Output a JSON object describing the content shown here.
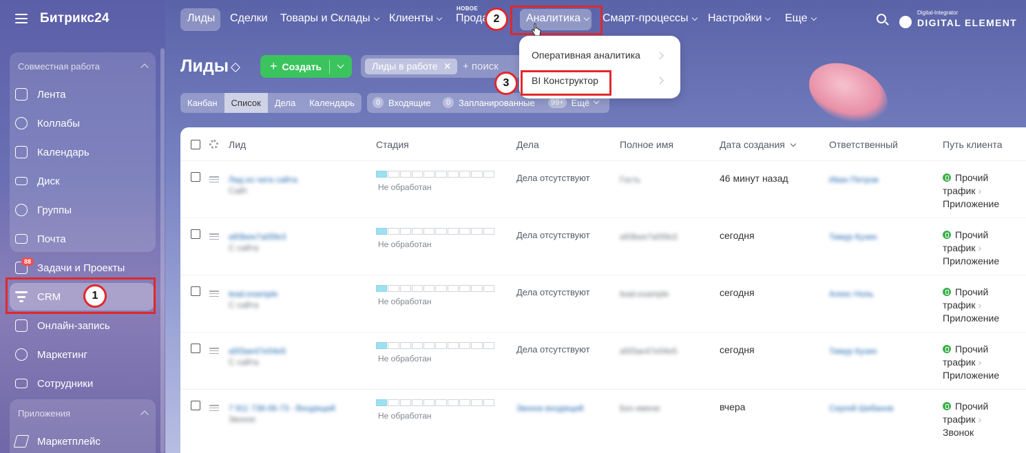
{
  "sidebar": {
    "logo": "Битрикс24",
    "groups": [
      {
        "label": "Совместная работа"
      },
      {
        "label": "Приложения"
      }
    ],
    "items": [
      {
        "label": "Лента"
      },
      {
        "label": "Коллабы"
      },
      {
        "label": "Календарь"
      },
      {
        "label": "Диск"
      },
      {
        "label": "Группы"
      },
      {
        "label": "Почта"
      },
      {
        "label": "Задачи и Проекты",
        "badge": "88"
      },
      {
        "label": "CRM"
      },
      {
        "label": "Онлайн-запись"
      },
      {
        "label": "Маркетинг"
      },
      {
        "label": "Сотрудники"
      },
      {
        "label": "Маркетплейс"
      }
    ]
  },
  "topnav": {
    "items": [
      {
        "label": "Лиды"
      },
      {
        "label": "Сделки"
      },
      {
        "label": "Товары и Склады"
      },
      {
        "label": "Клиенты"
      },
      {
        "label": "Прода"
      },
      {
        "label": "Аналитика"
      },
      {
        "label": "Смарт-процессы"
      },
      {
        "label": "Настройки"
      },
      {
        "label": "Еще"
      }
    ],
    "new_tag": "НОВОЕ",
    "brand_small": "Digital-Integrator",
    "brand_big": "DIGITAL ELEMENT"
  },
  "page": {
    "title": "Лиды",
    "create_label": "Создать",
    "filter_chip": "Лиды в работе",
    "search_placeholder": "+ поиск",
    "views": [
      "Канбан",
      "Список",
      "Дела",
      "Календарь"
    ],
    "counters": [
      {
        "n": "0",
        "label": "Входящие"
      },
      {
        "n": "0",
        "label": "Запланированные"
      },
      {
        "n": "99+",
        "label": "Ещё"
      }
    ]
  },
  "dropdown": {
    "items": [
      "Оперативная аналитика",
      "BI Конструктор"
    ]
  },
  "steps": [
    "1",
    "2",
    "3"
  ],
  "table": {
    "headers": [
      "Лид",
      "Стадия",
      "Дела",
      "Полное имя",
      "Дата создания",
      "Ответственный",
      "Путь клиента"
    ],
    "rows": [
      {
        "lead": "Лид из чата сайта",
        "lead2": "Сайт",
        "stage": "Не обработан",
        "deals": "Дела отсутствуют",
        "name": "Гость",
        "created": "46 минут назад",
        "owner": "Иван Петров",
        "path1": "Прочий",
        "path2": "трафик",
        "path3": "Приложение"
      },
      {
        "lead": "a93bee7a05fe3",
        "lead2": "С сайта",
        "stage": "Не обработан",
        "deals": "Дела отсутствуют",
        "name": "a93bee7a05fe3",
        "created": "сегодня",
        "owner": "Тимур Кузин",
        "path1": "Прочий",
        "path2": "трафик",
        "path3": "Приложение"
      },
      {
        "lead": "lead.example",
        "lead2": "С сайта",
        "stage": "Не обработан",
        "deals": "Дела отсутствуют",
        "name": "lead.example",
        "created": "сегодня",
        "owner": "Алекс Ноль",
        "path1": "Прочий",
        "path2": "трафик",
        "path3": "Приложение"
      },
      {
        "lead": "a5f3ae47e04e5",
        "lead2": "С сайта",
        "stage": "Не обработан",
        "deals": "Дела отсутствуют",
        "name": "a5f3ae47e04e5",
        "created": "сегодня",
        "owner": "Тимур Кузин",
        "path1": "Прочий",
        "path2": "трафик",
        "path3": "Приложение"
      },
      {
        "lead": "7 911 738-06-73 - Входящий",
        "lead2": "Звонок",
        "stage": "Не обработан",
        "deals": "Звонок входящий",
        "name": "Без имени",
        "created": "вчера",
        "owner": "Сергей Шибанов",
        "path1": "Прочий",
        "path2": "трафик",
        "path3": "Звонок"
      }
    ]
  }
}
